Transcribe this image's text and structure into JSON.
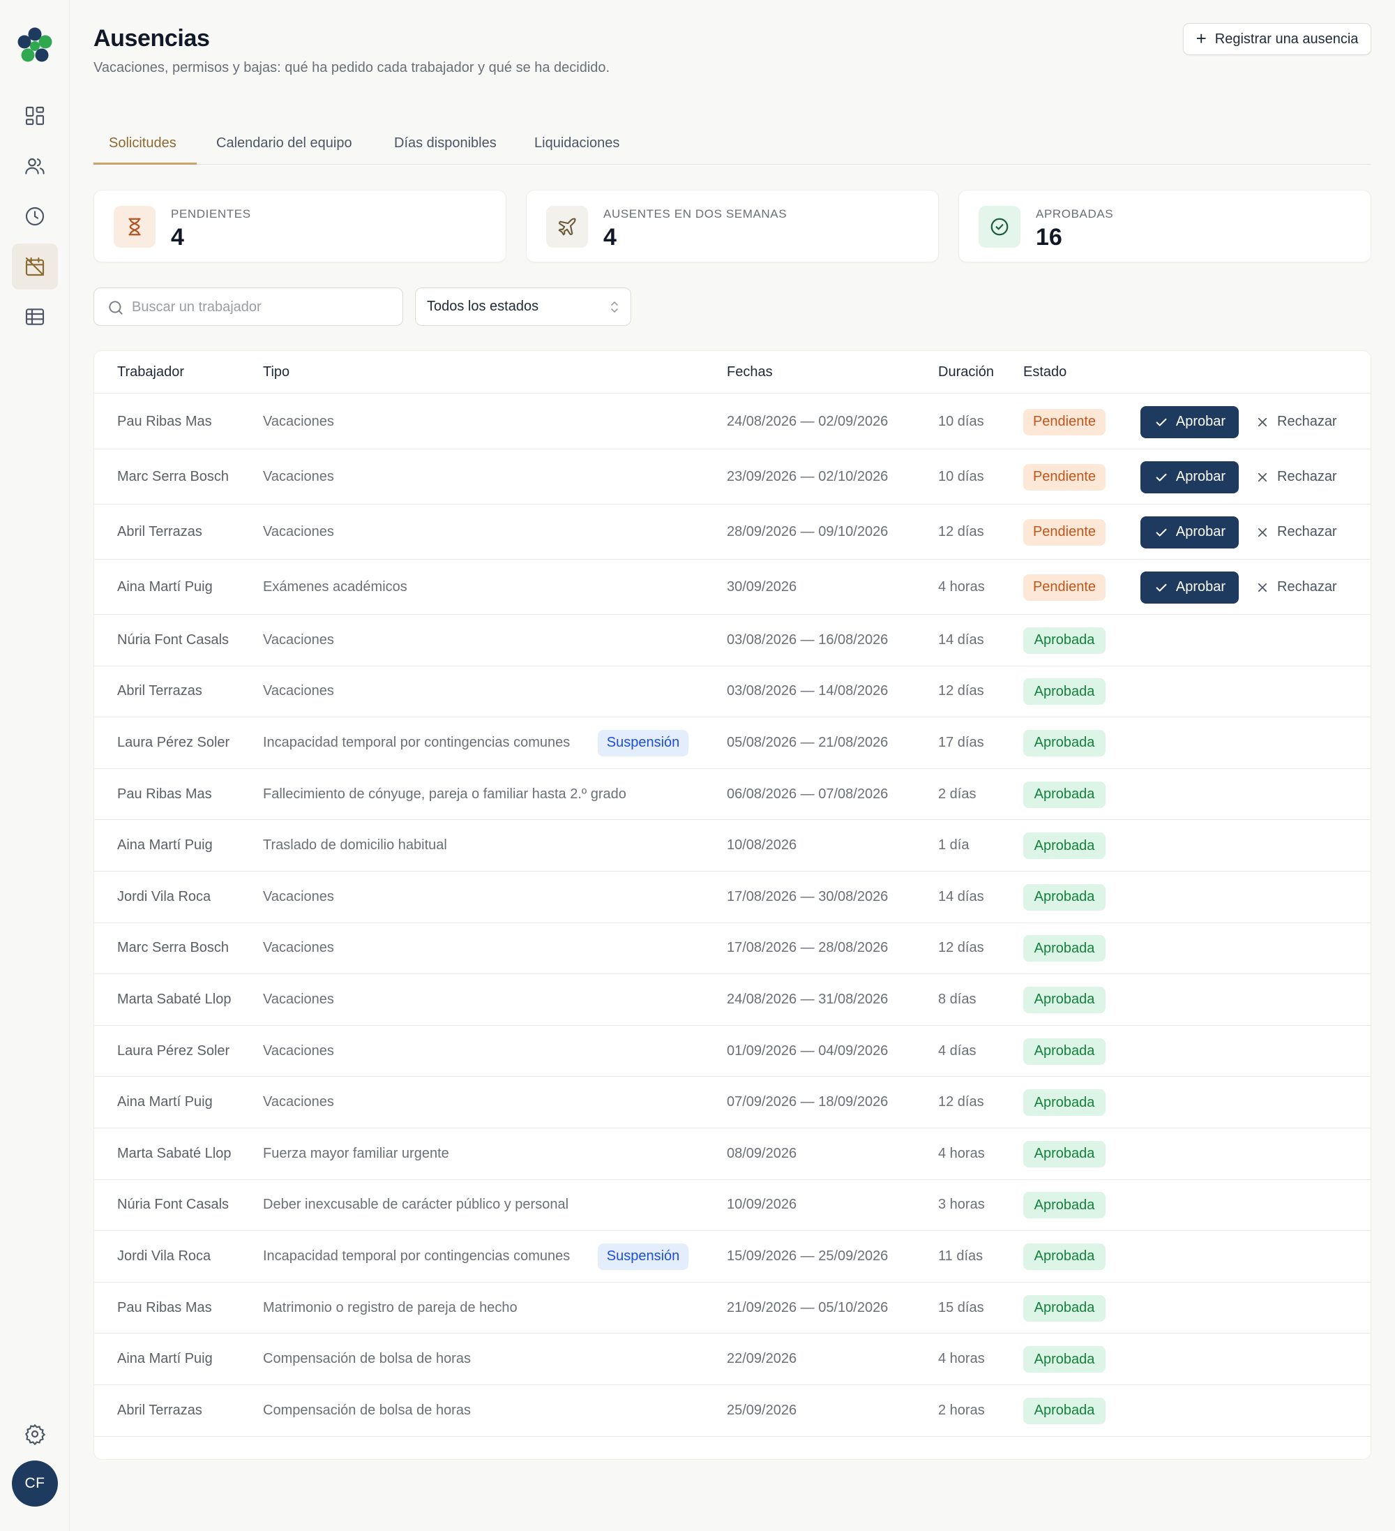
{
  "app": {
    "avatar_initials": "CF"
  },
  "colors": {
    "accent": "#1e3a5f",
    "tab_active": "#8c6a2f",
    "pending_bg": "#fde8d8",
    "pending_text": "#c2551a",
    "approved_bg": "#dcf5e6",
    "approved_text": "#15803d",
    "suspension_bg": "#e4edfb",
    "suspension_text": "#1d4ed8"
  },
  "sidebar": {
    "items": [
      {
        "icon": "dashboard-icon"
      },
      {
        "icon": "users-icon"
      },
      {
        "icon": "clock-icon"
      },
      {
        "icon": "calendar-off-icon",
        "active": true
      },
      {
        "icon": "table-icon"
      }
    ],
    "settings_icon": "gear-icon"
  },
  "header": {
    "title": "Ausencias",
    "subtitle": "Vacaciones, permisos y bajas: qué ha pedido cada trabajador y qué se ha decidido.",
    "register_button": "Registrar una ausencia"
  },
  "tabs": [
    "Solicitudes",
    "Calendario del equipo",
    "Días disponibles",
    "Liquidaciones"
  ],
  "stats": [
    {
      "label": "PENDIENTES",
      "value": "4",
      "icon": "hourglass-icon"
    },
    {
      "label": "AUSENTES EN DOS SEMANAS",
      "value": "4",
      "icon": "plane-icon"
    },
    {
      "label": "APROBADAS",
      "value": "16",
      "icon": "check-circle-icon"
    }
  ],
  "filters": {
    "search_placeholder": "Buscar un trabajador",
    "status_select": "Todos los estados"
  },
  "table": {
    "columns": [
      "Trabajador",
      "Tipo",
      "Fechas",
      "Duración",
      "Estado"
    ],
    "approve_label": "Aprobar",
    "reject_label": "Rechazar",
    "suspension_label": "Suspensión",
    "rows": [
      {
        "worker": "Pau Ribas Mas",
        "type": "Vacaciones",
        "dates": "24/08/2026 — 02/09/2026",
        "duration": "10 días",
        "status": "Pendiente",
        "pending": true
      },
      {
        "worker": "Marc Serra Bosch",
        "type": "Vacaciones",
        "dates": "23/09/2026 — 02/10/2026",
        "duration": "10 días",
        "status": "Pendiente",
        "pending": true
      },
      {
        "worker": "Abril Terrazas",
        "type": "Vacaciones",
        "dates": "28/09/2026 — 09/10/2026",
        "duration": "12 días",
        "status": "Pendiente",
        "pending": true
      },
      {
        "worker": "Aina Martí Puig",
        "type": "Exámenes académicos",
        "dates": "30/09/2026",
        "duration": "4 horas",
        "status": "Pendiente",
        "pending": true
      },
      {
        "worker": "Núria Font Casals",
        "type": "Vacaciones",
        "dates": "03/08/2026 — 16/08/2026",
        "duration": "14 días",
        "status": "Aprobada"
      },
      {
        "worker": "Abril Terrazas",
        "type": "Vacaciones",
        "dates": "03/08/2026 — 14/08/2026",
        "duration": "12 días",
        "status": "Aprobada"
      },
      {
        "worker": "Laura Pérez Soler",
        "type": "Incapacidad temporal por contingencias comunes",
        "suspension": true,
        "dates": "05/08/2026 — 21/08/2026",
        "duration": "17 días",
        "status": "Aprobada"
      },
      {
        "worker": "Pau Ribas Mas",
        "type": "Fallecimiento de cónyuge, pareja o familiar hasta 2.º grado",
        "dates": "06/08/2026 — 07/08/2026",
        "duration": "2 días",
        "status": "Aprobada"
      },
      {
        "worker": "Aina Martí Puig",
        "type": "Traslado de domicilio habitual",
        "dates": "10/08/2026",
        "duration": "1 día",
        "status": "Aprobada"
      },
      {
        "worker": "Jordi Vila Roca",
        "type": "Vacaciones",
        "dates": "17/08/2026 — 30/08/2026",
        "duration": "14 días",
        "status": "Aprobada"
      },
      {
        "worker": "Marc Serra Bosch",
        "type": "Vacaciones",
        "dates": "17/08/2026 — 28/08/2026",
        "duration": "12 días",
        "status": "Aprobada"
      },
      {
        "worker": "Marta Sabaté Llop",
        "type": "Vacaciones",
        "dates": "24/08/2026 — 31/08/2026",
        "duration": "8 días",
        "status": "Aprobada"
      },
      {
        "worker": "Laura Pérez Soler",
        "type": "Vacaciones",
        "dates": "01/09/2026 — 04/09/2026",
        "duration": "4 días",
        "status": "Aprobada"
      },
      {
        "worker": "Aina Martí Puig",
        "type": "Vacaciones",
        "dates": "07/09/2026 — 18/09/2026",
        "duration": "12 días",
        "status": "Aprobada"
      },
      {
        "worker": "Marta Sabaté Llop",
        "type": "Fuerza mayor familiar urgente",
        "dates": "08/09/2026",
        "duration": "4 horas",
        "status": "Aprobada"
      },
      {
        "worker": "Núria Font Casals",
        "type": "Deber inexcusable de carácter público y personal",
        "dates": "10/09/2026",
        "duration": "3 horas",
        "status": "Aprobada"
      },
      {
        "worker": "Jordi Vila Roca",
        "type": "Incapacidad temporal por contingencias comunes",
        "suspension": true,
        "dates": "15/09/2026 — 25/09/2026",
        "duration": "11 días",
        "status": "Aprobada"
      },
      {
        "worker": "Pau Ribas Mas",
        "type": "Matrimonio o registro de pareja de hecho",
        "dates": "21/09/2026 — 05/10/2026",
        "duration": "15 días",
        "status": "Aprobada"
      },
      {
        "worker": "Aina Martí Puig",
        "type": "Compensación de bolsa de horas",
        "dates": "22/09/2026",
        "duration": "4 horas",
        "status": "Aprobada"
      },
      {
        "worker": "Abril Terrazas",
        "type": "Compensación de bolsa de horas",
        "dates": "25/09/2026",
        "duration": "2 horas",
        "status": "Aprobada"
      }
    ]
  }
}
